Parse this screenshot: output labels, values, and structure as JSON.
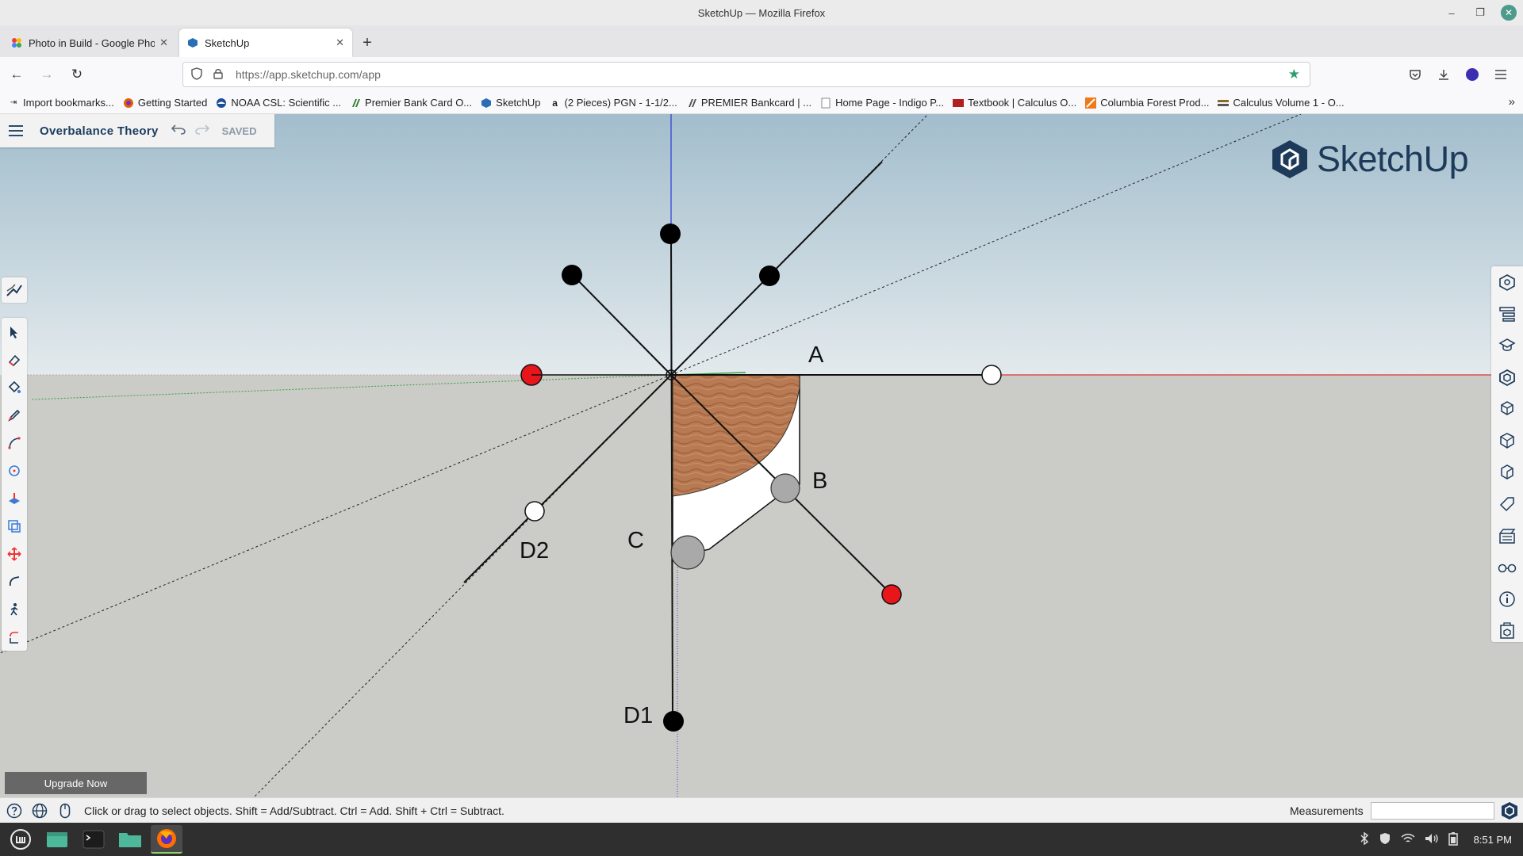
{
  "window": {
    "title": "SketchUp — Mozilla Firefox",
    "controls": {
      "minimize": "–",
      "maximize": "❐",
      "close": "✕"
    }
  },
  "tabs": [
    {
      "label": "Photo in Build - Google Phot",
      "close": "✕",
      "icon": "google-photos-icon"
    },
    {
      "label": "SketchUp",
      "close": "✕",
      "icon": "sketchup-icon",
      "active": true
    }
  ],
  "newtab": "+",
  "nav": {
    "back": "←",
    "forward": "→",
    "reload": "↻",
    "url": "https://app.sketchup.com/app",
    "bookmarked": "★"
  },
  "bookmarks": [
    {
      "label": "Import bookmarks...",
      "icon": "import-icon"
    },
    {
      "label": "Getting Started",
      "icon": "firefox-icon"
    },
    {
      "label": "NOAA CSL: Scientific ...",
      "icon": "noaa-icon"
    },
    {
      "label": "Premier Bank Card O...",
      "icon": "premier-icon"
    },
    {
      "label": "SketchUp",
      "icon": "sketchup-icon"
    },
    {
      "label": "(2 Pieces) PGN - 1-1/2...",
      "icon": "amazon-icon"
    },
    {
      "label": "PREMIER Bankcard | ...",
      "icon": "premier-icon"
    },
    {
      "label": "Home Page - Indigo P...",
      "icon": "page-icon"
    },
    {
      "label": "Textbook | Calculus O...",
      "icon": "textbook-icon"
    },
    {
      "label": "Columbia Forest Prod...",
      "icon": "columbia-icon"
    },
    {
      "label": "Calculus Volume 1 - O...",
      "icon": "openstax-icon"
    }
  ],
  "bookmarks_more": "»",
  "sketchup": {
    "doc_title": "Overbalance Theory",
    "saved_label": "SAVED",
    "logo_text": "SketchUp",
    "upgrade_label": "Upgrade Now",
    "scene_labels": {
      "a": "A",
      "b": "B",
      "c": "C",
      "d1": "D1",
      "d2": "D2"
    },
    "colors": {
      "sky_top": "#a2bdcc",
      "ground": "#cbcbc7",
      "wood": "#b87a52",
      "red_marker": "#e8151b",
      "blue_axis": "#2a38d8",
      "red_axis": "#d83a3a",
      "green_axis": "#3aa040",
      "brand": "#1d3a5a"
    },
    "left_tools": [
      "select-icon",
      "eraser-icon",
      "paint-bucket-icon",
      "pencil-icon",
      "arc-icon",
      "circle-icon",
      "push-pull-icon",
      "offset-icon",
      "move-icon",
      "tape-measure-icon",
      "walk-icon",
      "section-icon"
    ],
    "right_tools": [
      "entity-info-icon",
      "layers-icon",
      "instructor-icon",
      "components-icon",
      "materials-icon",
      "styles-icon",
      "scenes-icon",
      "tags-icon",
      "display-icon",
      "glasses-icon",
      "info-icon",
      "solid-inspector-icon"
    ]
  },
  "statusbar": {
    "hint": "Click or drag to select objects. Shift = Add/Subtract. Ctrl = Add. Shift + Ctrl = Subtract.",
    "measurements_label": "Measurements",
    "measurements_value": ""
  },
  "taskbar": {
    "clock": "8:51 PM"
  }
}
